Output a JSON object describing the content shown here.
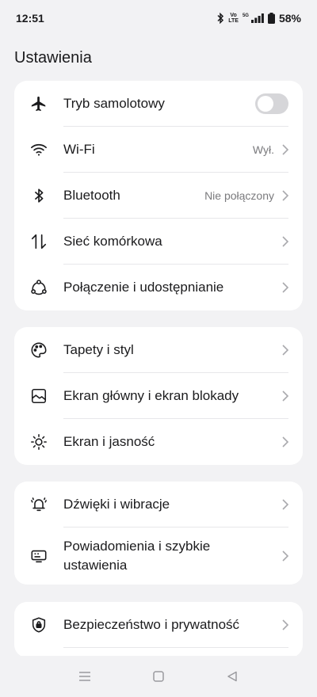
{
  "status_bar": {
    "time": "12:51",
    "volte_top": "Vo",
    "volte_bottom": "LTE",
    "network": "5G",
    "battery": "58%"
  },
  "header": {
    "title": "Ustawienia"
  },
  "groups": [
    {
      "items": [
        {
          "label": "Tryb samolotowy",
          "icon": "airplane-icon",
          "toggle": false
        },
        {
          "label": "Wi-Fi",
          "icon": "wifi-icon",
          "value": "Wył."
        },
        {
          "label": "Bluetooth",
          "icon": "bluetooth-icon",
          "value": "Nie połączony"
        },
        {
          "label": "Sieć komórkowa",
          "icon": "mobile-data-icon"
        },
        {
          "label": "Połączenie i udostępnianie",
          "icon": "connection-sharing-icon"
        }
      ]
    },
    {
      "items": [
        {
          "label": "Tapety i styl",
          "icon": "palette-icon"
        },
        {
          "label": "Ekran główny i ekran blokady",
          "icon": "home-screen-icon"
        },
        {
          "label": "Ekran i jasność",
          "icon": "brightness-icon"
        }
      ]
    },
    {
      "items": [
        {
          "label": "Dźwięki i wibracje",
          "icon": "bell-vibrate-icon"
        },
        {
          "label": "Powiadomienia i szybkie ustawienia",
          "icon": "notification-panel-icon"
        }
      ]
    },
    {
      "items": [
        {
          "label": "Bezpieczeństwo i prywatność",
          "icon": "shield-lock-icon"
        }
      ]
    }
  ],
  "colors": {
    "background": "#f2f2f4",
    "card": "#ffffff",
    "text": "#1b1b1d",
    "secondary": "#7a7a7d"
  }
}
